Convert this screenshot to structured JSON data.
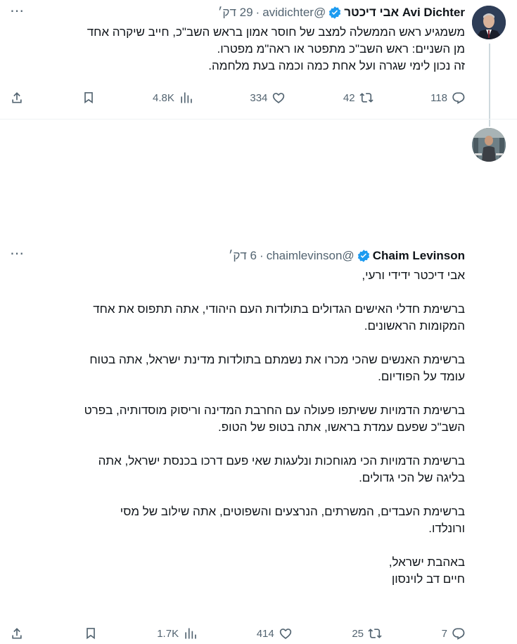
{
  "tweets": [
    {
      "display_name": "Avi Dichter אבי דיכטר",
      "handle": "@avidichter",
      "time": "29 דק׳",
      "paragraphs": [
        [
          "משמגיע ראש הממשלה למצב של חוסר אמון בראש השב\"כ, חייב שיקרה אחד",
          "מן השניים: ראש השב\"כ מתפטר או ראה\"מ מפטרו.",
          "זה נכון לימי שגרה ועל אחת כמה וכמה בעת מלחמה."
        ]
      ],
      "stats": {
        "replies": "118",
        "reposts": "42",
        "likes": "334",
        "views": "4.8K"
      }
    },
    {
      "display_name": "Chaim Levinson",
      "handle": "@chaimlevinson",
      "time": "6 דק׳",
      "paragraphs": [
        [
          "אבי דיכטר ידידי ורעי,"
        ],
        [
          "ברשימת חדלי האישים הגדולים בתולדות העם היהודי, אתה תתפוס את אחד",
          "המקומות הראשונים."
        ],
        [
          "ברשימת האנשים שהכי מכרו את נשמתם בתולדות מדינת ישראל, אתה בטוח",
          "עומד על הפודיום."
        ],
        [
          "ברשימת הדמויות ששיתפו פעולה עם החרבת המדינה וריסוק מוסדותיה, בפרט",
          "השב\"כ שפעם עמדת בראשו, אתה בטופ של הטופ."
        ],
        [
          "ברשימת הדמויות הכי מגוחכות ונלעגות שאי פעם דרכו בכנסת ישראל, אתה",
          "בליגה של הכי גדולים."
        ],
        [
          "ברשימת העבדים, המשרתים, הנרצעים והשפוטים, אתה שילוב של מסי",
          "ורונלדו."
        ],
        [
          "באהבת ישראל,",
          "חיים דב לוינסון"
        ]
      ],
      "stats": {
        "replies": "7",
        "reposts": "25",
        "likes": "414",
        "views": "1.7K"
      }
    }
  ],
  "icons": {
    "verified": "verified-badge-icon",
    "more": "more-icon",
    "reply": "reply-icon",
    "repost": "repost-icon",
    "like": "like-icon",
    "views": "views-icon",
    "bookmark": "bookmark-icon",
    "share": "share-icon"
  },
  "colors": {
    "verified": "#1d9bf0",
    "text": "#0f1419",
    "muted": "#536471",
    "divider": "#eff3f4"
  }
}
